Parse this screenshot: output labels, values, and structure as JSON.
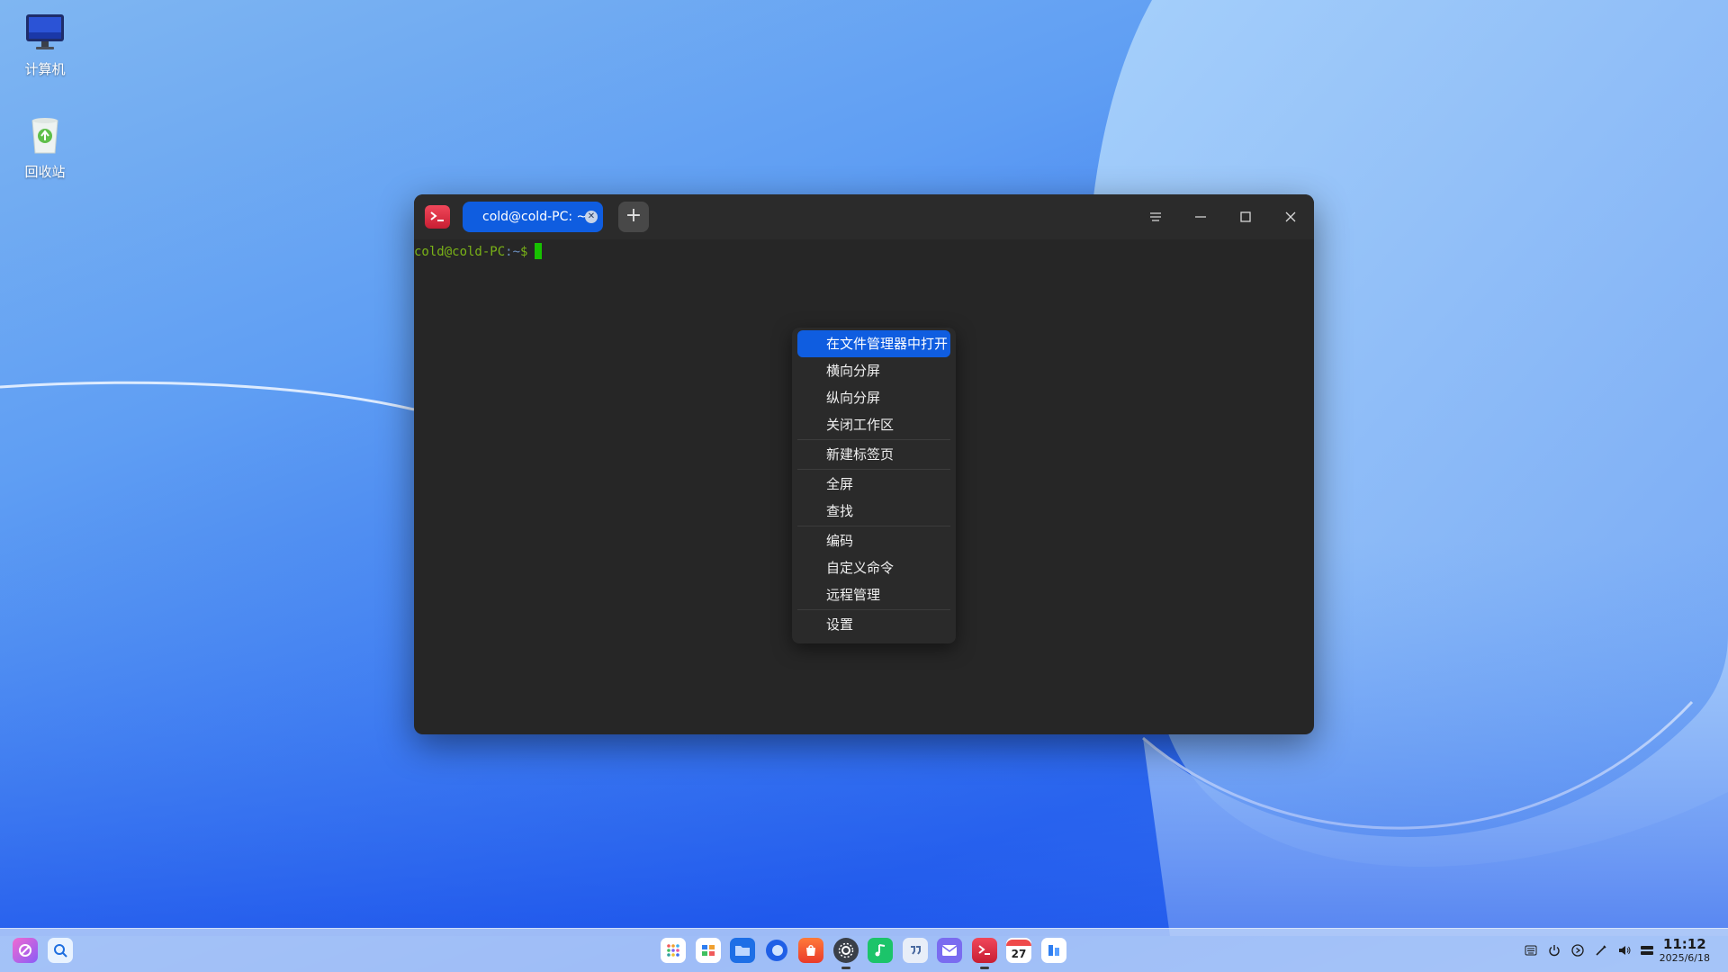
{
  "desktop": {
    "icons": [
      {
        "label": "计算机",
        "icon": "monitor-icon"
      },
      {
        "label": "回收站",
        "icon": "trash-icon"
      }
    ]
  },
  "terminal": {
    "tab_title": "cold@cold-PC: ~",
    "prompt": {
      "user_host": "cold@cold-PC",
      "sep": ":",
      "dir": "~",
      "dollar": "$"
    },
    "accent": "#0f5de0"
  },
  "context_menu": {
    "items": [
      {
        "label": "在文件管理器中打开",
        "active": true
      },
      {
        "label": "横向分屏"
      },
      {
        "label": "纵向分屏"
      },
      {
        "label": "关闭工作区"
      },
      {
        "label": "新建标签页"
      },
      {
        "label": "全屏"
      },
      {
        "label": "查找"
      },
      {
        "label": "编码"
      },
      {
        "label": "自定义命令"
      },
      {
        "label": "远程管理"
      },
      {
        "label": "设置"
      }
    ]
  },
  "taskbar": {
    "apps": [
      "launcher-icon",
      "multitask-icon",
      "file-manager-icon",
      "browser-icon",
      "app-store-icon",
      "settings-icon",
      "music-icon",
      "chat-icon",
      "mail-icon",
      "terminal-icon",
      "calendar-icon",
      "recorder-icon"
    ],
    "calendar_day": "27",
    "tray": [
      "keyboard-icon",
      "power-icon",
      "media-icon",
      "pen-icon",
      "volume-icon",
      "network-icon"
    ],
    "time": "11:12",
    "date": "2025/6/18"
  }
}
